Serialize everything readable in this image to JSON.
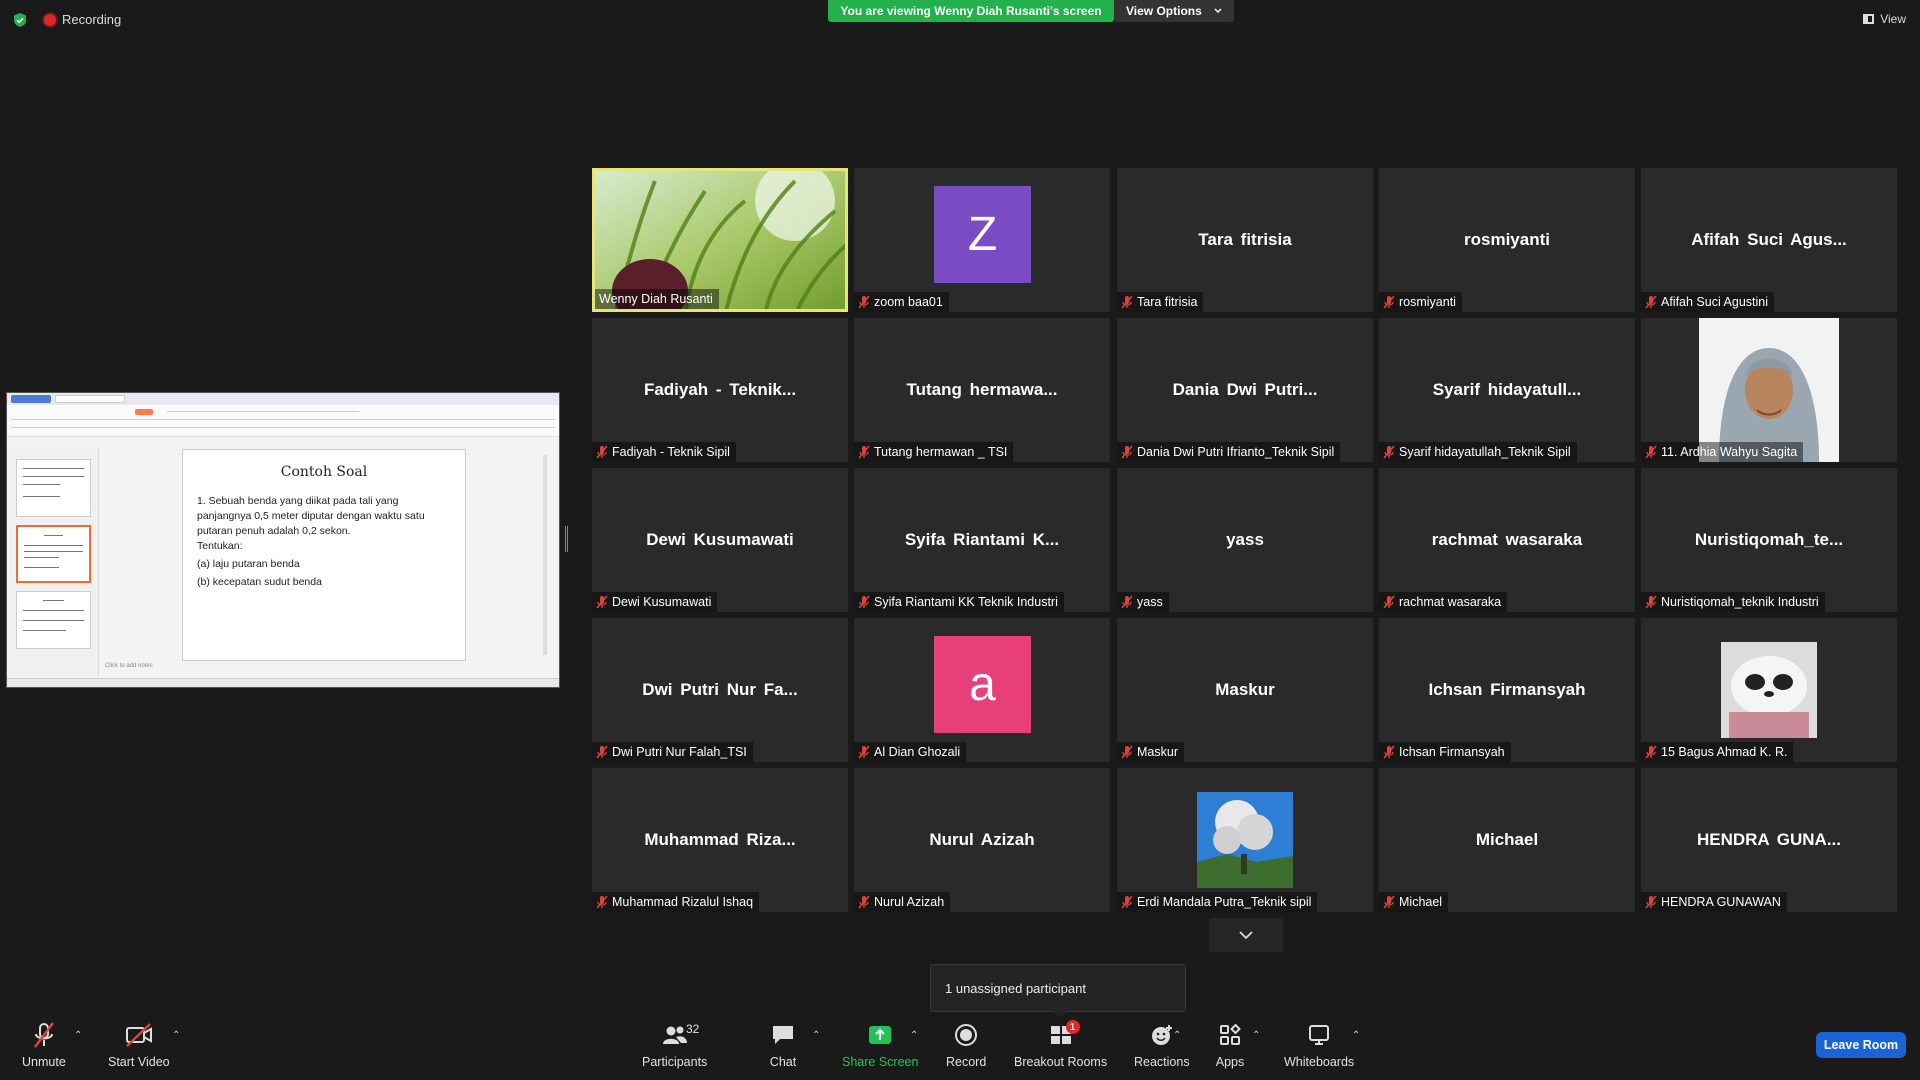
{
  "top": {
    "recording": "Recording",
    "viewing_banner": "You are viewing Wenny Diah Rusanti's screen",
    "view_options": "View Options",
    "view": "View"
  },
  "shared_screen": {
    "slide_title": "Contoh Soal",
    "lines": [
      "1. Sebuah benda yang diikat pada tali yang panjangnya 0,5 meter diputar dengan waktu satu putaran penuh adalah 0,2 sekon.",
      "Tentukan:",
      "(a) laju putaran benda",
      "(b) kecepatan sudut benda"
    ],
    "notes_hint": "Click to add notes"
  },
  "participants": [
    {
      "center": "",
      "label": "Wenny Diah Rusanti",
      "muted": false,
      "type": "grass",
      "active": true
    },
    {
      "center": "",
      "label": "zoom baa01",
      "muted": true,
      "type": "avatar",
      "avatar_letter": "Z",
      "avatar_color": "#7b4bc4"
    },
    {
      "center": "Tara fitrisia",
      "label": "Tara fitrisia",
      "muted": true,
      "type": "name"
    },
    {
      "center": "rosmiyanti",
      "label": "rosmiyanti",
      "muted": true,
      "type": "name"
    },
    {
      "center": "Afifah Suci Agus...",
      "label": "Afifah Suci Agustini",
      "muted": true,
      "type": "name"
    },
    {
      "center": "Fadiyah - Teknik...",
      "label": "Fadiyah - Teknik Sipil",
      "muted": true,
      "type": "name"
    },
    {
      "center": "Tutang hermawa...",
      "label": "Tutang hermawan _ TSI",
      "muted": true,
      "type": "name"
    },
    {
      "center": "Dania Dwi Putri...",
      "label": "Dania Dwi Putri Ifrianto_Teknik Sipil",
      "muted": true,
      "type": "name"
    },
    {
      "center": "Syarif hidayatull...",
      "label": "Syarif hidayatullah_Teknik Sipil",
      "muted": true,
      "type": "name"
    },
    {
      "center": "",
      "label": "11. Ardhia Wahyu Sagita",
      "muted": true,
      "type": "portrait"
    },
    {
      "center": "Dewi Kusumawati",
      "label": "Dewi Kusumawati",
      "muted": true,
      "type": "name"
    },
    {
      "center": "Syifa Riantami K...",
      "label": "Syifa Riantami KK Teknik Industri",
      "muted": true,
      "type": "name"
    },
    {
      "center": "yass",
      "label": "yass",
      "muted": true,
      "type": "name"
    },
    {
      "center": "rachmat wasaraka",
      "label": "rachmat wasaraka",
      "muted": true,
      "type": "name"
    },
    {
      "center": "Nuristiqomah_te...",
      "label": "Nuristiqomah_teknik Industri",
      "muted": true,
      "type": "name"
    },
    {
      "center": "Dwi Putri Nur Fa...",
      "label": "Dwi Putri Nur Falah_TSI",
      "muted": true,
      "type": "name"
    },
    {
      "center": "",
      "label": "Al Dian Ghozali",
      "muted": true,
      "type": "avatar",
      "avatar_letter": "a",
      "avatar_color": "#e8407a"
    },
    {
      "center": "Maskur",
      "label": "Maskur",
      "muted": true,
      "type": "name"
    },
    {
      "center": "Ichsan Firmansyah",
      "label": "Ichsan Firmansyah",
      "muted": true,
      "type": "name"
    },
    {
      "center": "",
      "label": "15 Bagus Ahmad K. R.",
      "muted": true,
      "type": "panda"
    },
    {
      "center": "Muhammad Riza...",
      "label": "Muhammad Rizalul Ishaq",
      "muted": true,
      "type": "name"
    },
    {
      "center": "Nurul Azizah",
      "label": "Nurul Azizah",
      "muted": true,
      "type": "name"
    },
    {
      "center": "",
      "label": "Erdi Mandala Putra_Teknik sipil",
      "muted": true,
      "type": "volcano"
    },
    {
      "center": "Michael",
      "label": "Michael",
      "muted": true,
      "type": "name"
    },
    {
      "center": "HENDRA GUNA...",
      "label": "HENDRA GUNAWAN",
      "muted": true,
      "type": "name"
    }
  ],
  "tooltip": "1 unassigned participant",
  "toolbar": {
    "unmute": "Unmute",
    "start_video": "Start Video",
    "participants": "Participants",
    "participants_count": "32",
    "chat": "Chat",
    "share_screen": "Share Screen",
    "record": "Record",
    "breakout_rooms": "Breakout Rooms",
    "breakout_badge": "1",
    "reactions": "Reactions",
    "apps": "Apps",
    "whiteboards": "Whiteboards",
    "leave": "Leave Room"
  },
  "colors": {
    "viewing_green": "#23b14d",
    "active_border": "#e9e37a",
    "leave_blue": "#1b64d8",
    "mute_red": "#e0423b"
  }
}
